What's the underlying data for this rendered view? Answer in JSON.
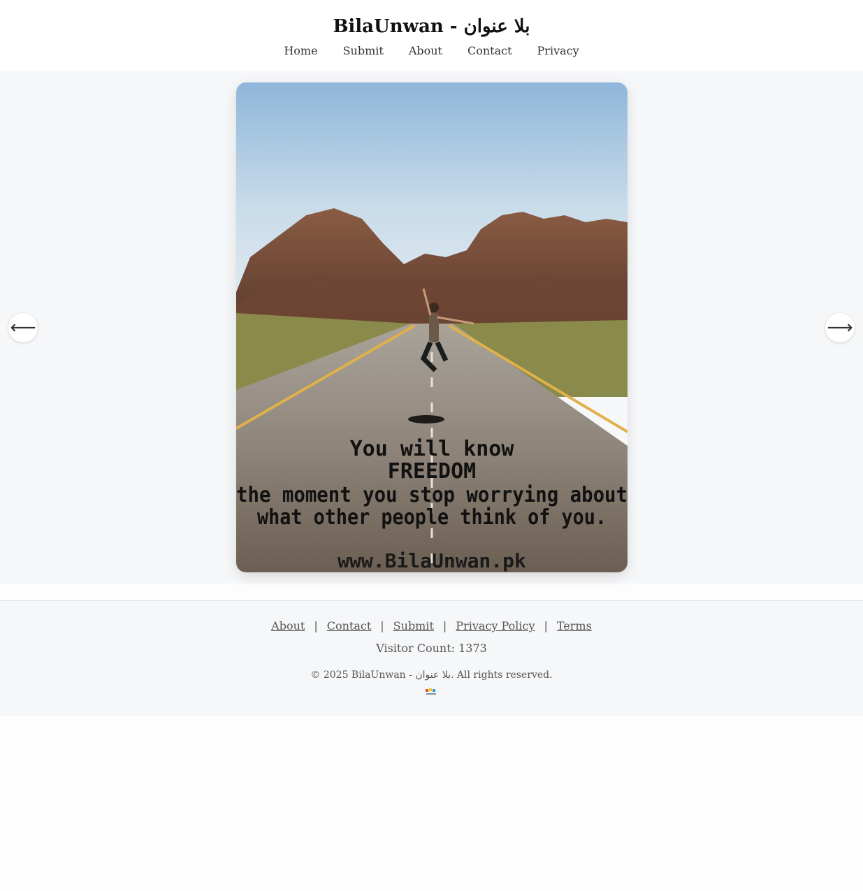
{
  "site": {
    "title": "BilaUnwan - بلا عنوان"
  },
  "nav": {
    "items": [
      {
        "label": "Home"
      },
      {
        "label": "Submit"
      },
      {
        "label": "About"
      },
      {
        "label": "Contact"
      },
      {
        "label": "Privacy"
      }
    ]
  },
  "carousel": {
    "prev_label": "⟵",
    "next_label": "⟶",
    "slide": {
      "quote_line1": "You will know",
      "quote_line2": "FREEDOM",
      "quote_line3": "the moment you stop worrying about",
      "quote_line4": "what other people think of you.",
      "watermark": "www.BilaUnwan.pk"
    }
  },
  "footer": {
    "links": [
      {
        "label": "About"
      },
      {
        "label": "Contact"
      },
      {
        "label": "Submit"
      },
      {
        "label": "Privacy Policy"
      },
      {
        "label": "Terms"
      }
    ],
    "separator": "|",
    "visitor_count": "Visitor Count: 1373",
    "copyright": "© 2025 BilaUnwan - بلا عنوان. All rights reserved."
  },
  "colors": {
    "header_bg": "#ffffff",
    "main_bg": "#f6f7f9",
    "text": "#333333"
  }
}
